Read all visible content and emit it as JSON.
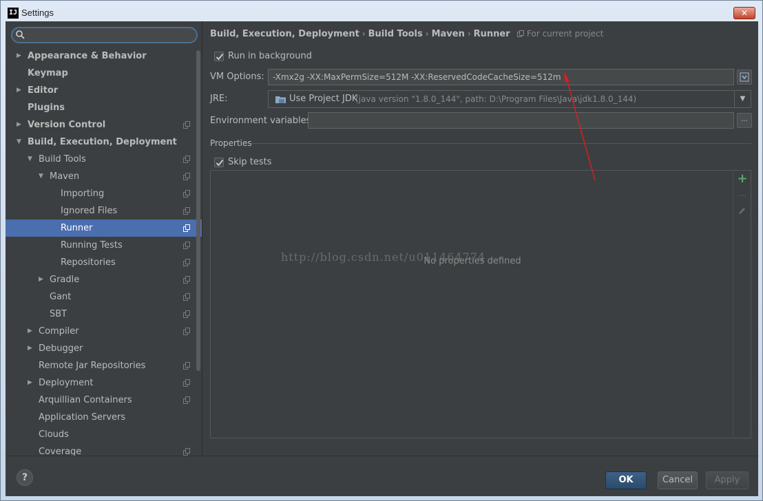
{
  "window": {
    "title": "Settings",
    "app_logo": "IJ",
    "close_label": "✕"
  },
  "sidebar": {
    "search": {
      "value": "",
      "placeholder": ""
    },
    "items": [
      {
        "label": "Appearance & Behavior",
        "bold": true,
        "arrow": "right",
        "project": false,
        "selected": false
      },
      {
        "label": "Keymap",
        "bold": true,
        "arrow": "",
        "project": false,
        "selected": false
      },
      {
        "label": "Editor",
        "bold": true,
        "arrow": "right",
        "project": false,
        "selected": false
      },
      {
        "label": "Plugins",
        "bold": true,
        "arrow": "",
        "project": false,
        "selected": false
      },
      {
        "label": "Version Control",
        "bold": true,
        "arrow": "right",
        "project": true,
        "selected": false
      },
      {
        "label": "Build, Execution, Deployment",
        "bold": true,
        "arrow": "down",
        "project": false,
        "selected": false
      },
      {
        "label": "Build Tools",
        "bold": false,
        "arrow": "down",
        "project": true,
        "selected": false
      },
      {
        "label": "Maven",
        "bold": false,
        "arrow": "down",
        "project": true,
        "selected": false
      },
      {
        "label": "Importing",
        "bold": false,
        "arrow": "",
        "project": true,
        "selected": false
      },
      {
        "label": "Ignored Files",
        "bold": false,
        "arrow": "",
        "project": true,
        "selected": false
      },
      {
        "label": "Runner",
        "bold": false,
        "arrow": "",
        "project": true,
        "selected": true
      },
      {
        "label": "Running Tests",
        "bold": false,
        "arrow": "",
        "project": true,
        "selected": false
      },
      {
        "label": "Repositories",
        "bold": false,
        "arrow": "",
        "project": true,
        "selected": false
      },
      {
        "label": "Gradle",
        "bold": false,
        "arrow": "right",
        "project": true,
        "selected": false
      },
      {
        "label": "Gant",
        "bold": false,
        "arrow": "",
        "project": true,
        "selected": false
      },
      {
        "label": "SBT",
        "bold": false,
        "arrow": "",
        "project": true,
        "selected": false
      },
      {
        "label": "Compiler",
        "bold": false,
        "arrow": "right",
        "project": true,
        "selected": false
      },
      {
        "label": "Debugger",
        "bold": false,
        "arrow": "right",
        "project": false,
        "selected": false
      },
      {
        "label": "Remote Jar Repositories",
        "bold": false,
        "arrow": "",
        "project": true,
        "selected": false
      },
      {
        "label": "Deployment",
        "bold": false,
        "arrow": "right",
        "project": true,
        "selected": false
      },
      {
        "label": "Arquillian Containers",
        "bold": false,
        "arrow": "",
        "project": true,
        "selected": false
      },
      {
        "label": "Application Servers",
        "bold": false,
        "arrow": "",
        "project": false,
        "selected": false
      },
      {
        "label": "Clouds",
        "bold": false,
        "arrow": "",
        "project": false,
        "selected": false
      },
      {
        "label": "Coverage",
        "bold": false,
        "arrow": "",
        "project": true,
        "selected": false
      }
    ]
  },
  "main": {
    "breadcrumb": [
      "Build, Execution, Deployment",
      "Build Tools",
      "Maven",
      "Runner"
    ],
    "breadcrumb_separator": "›",
    "scope_label": "For current project",
    "run_in_background": {
      "label": "Run in background",
      "checked": true
    },
    "vm_options": {
      "label": "VM Options:",
      "value": "-Xmx2g -XX:MaxPermSize=512M -XX:ReservedCodeCacheSize=512m"
    },
    "jre": {
      "label": "JRE:",
      "selected": "Use Project JDK",
      "detail": "(java version \"1.8.0_144\", path: D:\\Program Files\\Java\\jdk1.8.0_144)"
    },
    "env_vars": {
      "label": "Environment variables:",
      "value": "",
      "browse_label": "..."
    },
    "properties": {
      "title": "Properties",
      "skip_tests": {
        "label": "Skip tests",
        "checked": true
      },
      "empty_text": "No properties defined",
      "add_label": "+",
      "remove_label": "—"
    },
    "watermark": "http://blog.csdn.net/u011464774"
  },
  "footer": {
    "help_label": "?",
    "ok_label": "OK",
    "cancel_label": "Cancel",
    "apply_label": "Apply"
  },
  "colors": {
    "accent": "#4b6eaf",
    "background": "#3c3f41",
    "text": "#bbbbbb",
    "add_green": "#59a869",
    "annotation_red": "#d42020"
  }
}
